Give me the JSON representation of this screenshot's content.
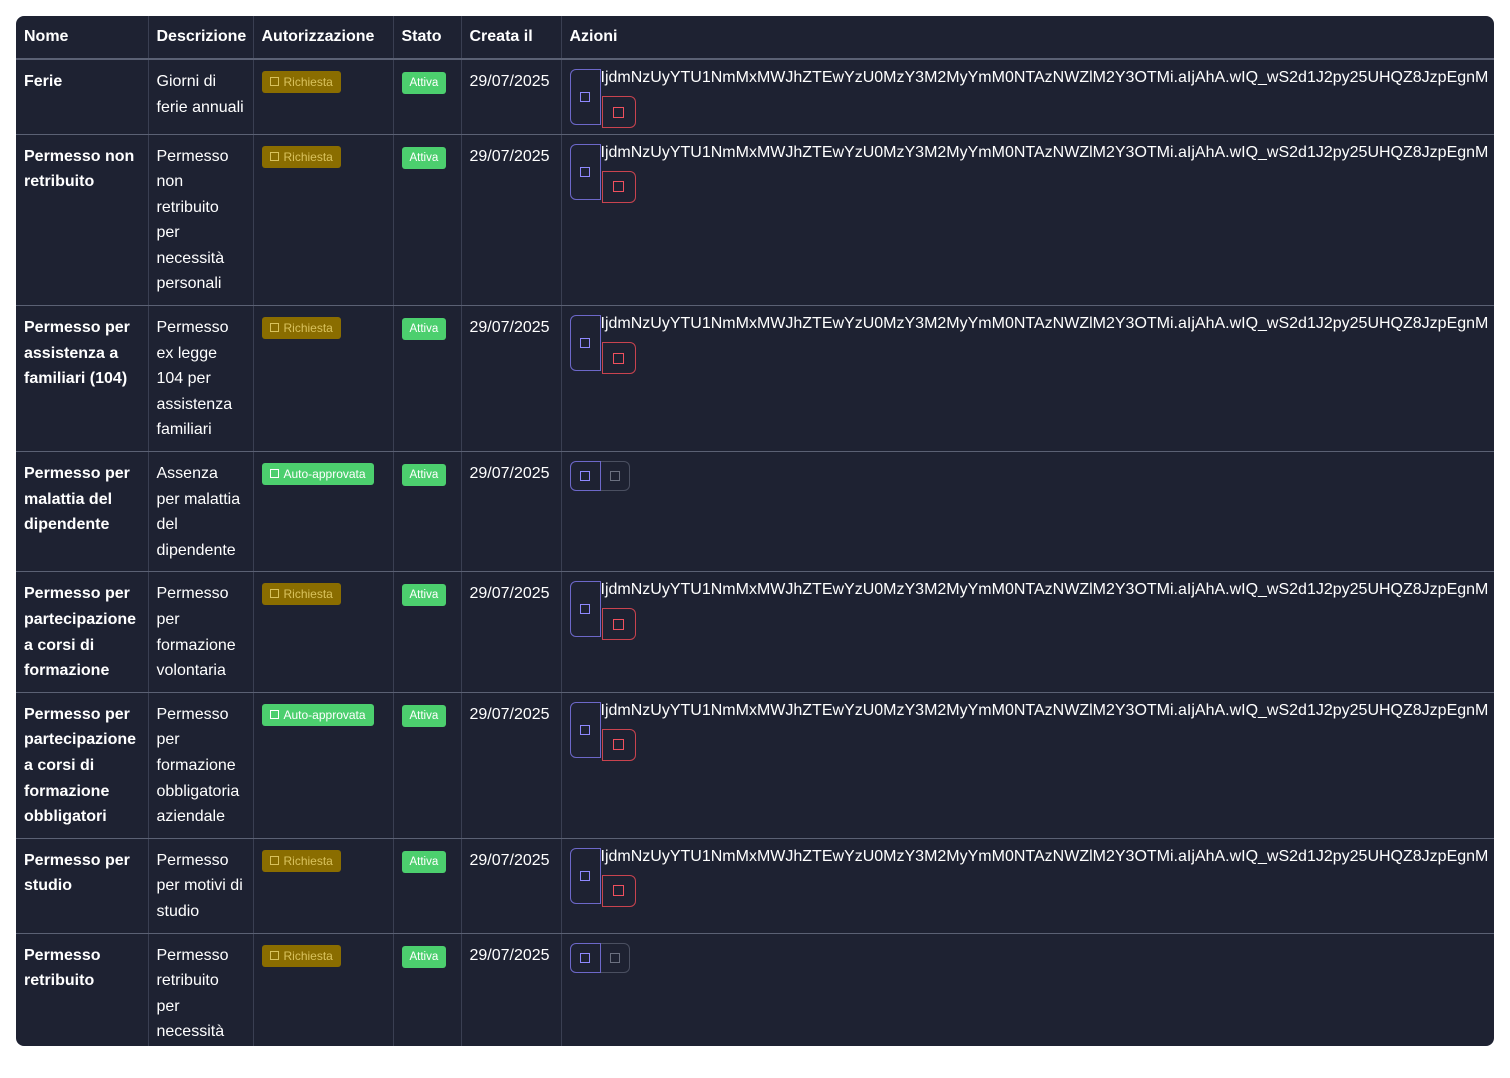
{
  "headers": {
    "name": "Nome",
    "description": "Descrizione",
    "authorization": "Autorizzazione",
    "status": "Stato",
    "created": "Creata il",
    "actions": "Azioni"
  },
  "colors": {
    "table_bg": "#1e2232",
    "badge_required_bg": "#8a6d00",
    "badge_auto_bg": "#4ccf6e",
    "badge_active_bg": "#4ccf6e",
    "edit_button_border": "#6d68c9",
    "delete_button_border": "#c9434f"
  },
  "rows": [
    {
      "name": "Ferie",
      "description": "Giorni di ferie annuali",
      "authorization": "Richiesta",
      "auth_type": "required",
      "status": "Attiva",
      "created": "29/07/2025",
      "action_token": "IjdmNzUyYTU1NmMxMWJhZTEwYzU0MzY3M2MyYmM0NTAzNWZlM2Y3OTMi.aIjAhA.wIQ_wS2d1J2py25UHQZ8JzpEgnM",
      "deletable": true
    },
    {
      "name": "Permesso non retribuito",
      "description": "Permesso non retribuito per necessità personali",
      "authorization": "Richiesta",
      "auth_type": "required",
      "status": "Attiva",
      "created": "29/07/2025",
      "action_token": "IjdmNzUyYTU1NmMxMWJhZTEwYzU0MzY3M2MyYmM0NTAzNWZlM2Y3OTMi.aIjAhA.wIQ_wS2d1J2py25UHQZ8JzpEgnM",
      "deletable": true
    },
    {
      "name": "Permesso per assistenza a familiari (104)",
      "description": "Permesso ex legge 104 per assistenza familiari",
      "authorization": "Richiesta",
      "auth_type": "required",
      "status": "Attiva",
      "created": "29/07/2025",
      "action_token": "IjdmNzUyYTU1NmMxMWJhZTEwYzU0MzY3M2MyYmM0NTAzNWZlM2Y3OTMi.aIjAhA.wIQ_wS2d1J2py25UHQZ8JzpEgnM",
      "deletable": true
    },
    {
      "name": "Permesso per malattia del dipendente",
      "description": "Assenza per malattia del dipendente",
      "authorization": "Auto-approvata",
      "auth_type": "auto",
      "status": "Attiva",
      "created": "29/07/2025",
      "action_token": "",
      "deletable": false
    },
    {
      "name": "Permesso per partecipazione a corsi di formazione",
      "description": "Permesso per formazione volontaria",
      "authorization": "Richiesta",
      "auth_type": "required",
      "status": "Attiva",
      "created": "29/07/2025",
      "action_token": "IjdmNzUyYTU1NmMxMWJhZTEwYzU0MzY3M2MyYmM0NTAzNWZlM2Y3OTMi.aIjAhA.wIQ_wS2d1J2py25UHQZ8JzpEgnM",
      "deletable": true
    },
    {
      "name": "Permesso per partecipazione a corsi di formazione obbligatori",
      "description": "Permesso per formazione obbligatoria aziendale",
      "authorization": "Auto-approvata",
      "auth_type": "auto",
      "status": "Attiva",
      "created": "29/07/2025",
      "action_token": "IjdmNzUyYTU1NmMxMWJhZTEwYzU0MzY3M2MyYmM0NTAzNWZlM2Y3OTMi.aIjAhA.wIQ_wS2d1J2py25UHQZ8JzpEgnM",
      "deletable": true
    },
    {
      "name": "Permesso per studio",
      "description": "Permesso per motivi di studio",
      "authorization": "Richiesta",
      "auth_type": "required",
      "status": "Attiva",
      "created": "29/07/2025",
      "action_token": "IjdmNzUyYTU1NmMxMWJhZTEwYzU0MzY3M2MyYmM0NTAzNWZlM2Y3OTMi.aIjAhA.wIQ_wS2d1J2py25UHQZ8JzpEgnM",
      "deletable": true
    },
    {
      "name": "Permesso retribuito",
      "description": "Permesso retribuito per necessità personali",
      "authorization": "Richiesta",
      "auth_type": "required",
      "status": "Attiva",
      "created": "29/07/2025",
      "action_token": "",
      "deletable": false
    }
  ]
}
